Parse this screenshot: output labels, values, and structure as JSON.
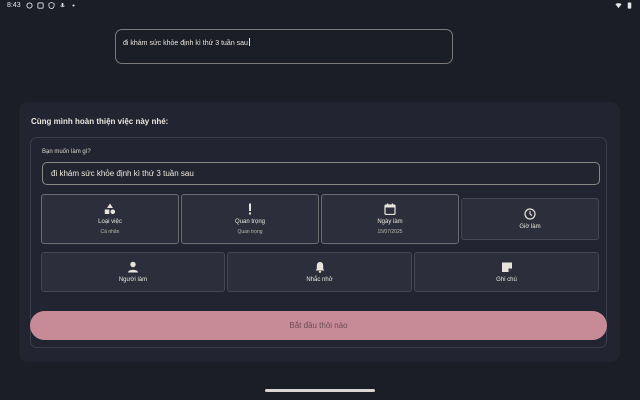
{
  "status_bar": {
    "time": "8:43"
  },
  "top_input": {
    "value": "đi khám sức khỏe định kì thứ 3 tuần sau"
  },
  "panel": {
    "title": "Cùng mình hoàn thiện việc này nhé:",
    "field_label": "Bạn muốn làm gì?",
    "field_value": "đi khám sức khỏe định kì thứ 3 tuần sau",
    "options_row1": [
      {
        "label": "Loại việc",
        "value": "Cá nhân",
        "icon": "shapes-icon"
      },
      {
        "label": "Quan trọng",
        "value": "Quan trọng",
        "icon": "exclamation-icon"
      },
      {
        "label": "Ngày làm",
        "value": "15/07/2025",
        "icon": "calendar-icon"
      },
      {
        "label": "Giờ làm",
        "value": "",
        "icon": "clock-icon"
      }
    ],
    "options_row2": [
      {
        "label": "Người làm",
        "icon": "person-icon"
      },
      {
        "label": "Nhắc nhở",
        "icon": "bell-icon"
      },
      {
        "label": "Ghi chú",
        "icon": "note-icon"
      }
    ],
    "submit_label": "Bắt đầu thôi nào"
  },
  "colors": {
    "background": "#1b1d27",
    "panel": "#222431",
    "accent_button": "#c68b97"
  }
}
